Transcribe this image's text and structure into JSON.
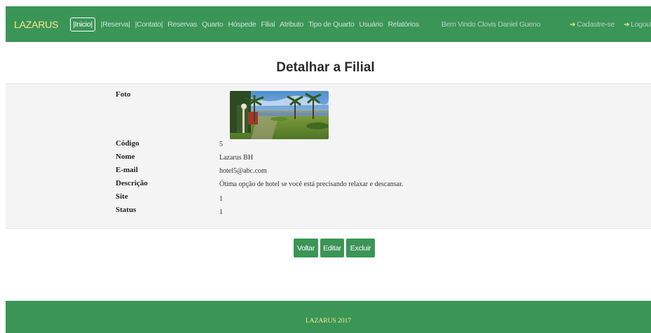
{
  "nav": {
    "brand": "LAZARUS",
    "links": [
      {
        "label": "|Inicio|",
        "active": true
      },
      {
        "label": "|Reserva|"
      },
      {
        "label": "|Contato|"
      },
      {
        "label": "Reservas"
      },
      {
        "label": "Quarto"
      },
      {
        "label": "Hóspede"
      },
      {
        "label": "Filial"
      },
      {
        "label": "Atributo"
      },
      {
        "label": "Tipo de Quarto"
      },
      {
        "label": "Usuário"
      },
      {
        "label": "Relatórios"
      }
    ],
    "welcome": "Bem Vindo Clovis Daniel Gueno",
    "signup": "Cadastre-se",
    "logout": "Logout",
    "signin_icon": "sign-in-icon"
  },
  "page": {
    "title": "Detalhar a Filial"
  },
  "detail": {
    "foto_label": "Foto",
    "fields": [
      {
        "label": "Código",
        "value": "5"
      },
      {
        "label": "Nome",
        "value": "Lazarus BH"
      },
      {
        "label": "E-mail",
        "value": "hotel5@abc.com"
      },
      {
        "label": "Descrição",
        "value": "Ótima opção de hotel se você está precisando relaxar e descansar."
      },
      {
        "label": "Site",
        "value": "1"
      },
      {
        "label": "Status",
        "value": "1"
      }
    ]
  },
  "actions": {
    "back": "Voltar",
    "edit": "Editar",
    "delete": "Excluir"
  },
  "footer": {
    "text": "LAZARUS 2017"
  },
  "colors": {
    "primary": "#3a9557",
    "brand_yellow": "#ffe98a"
  }
}
